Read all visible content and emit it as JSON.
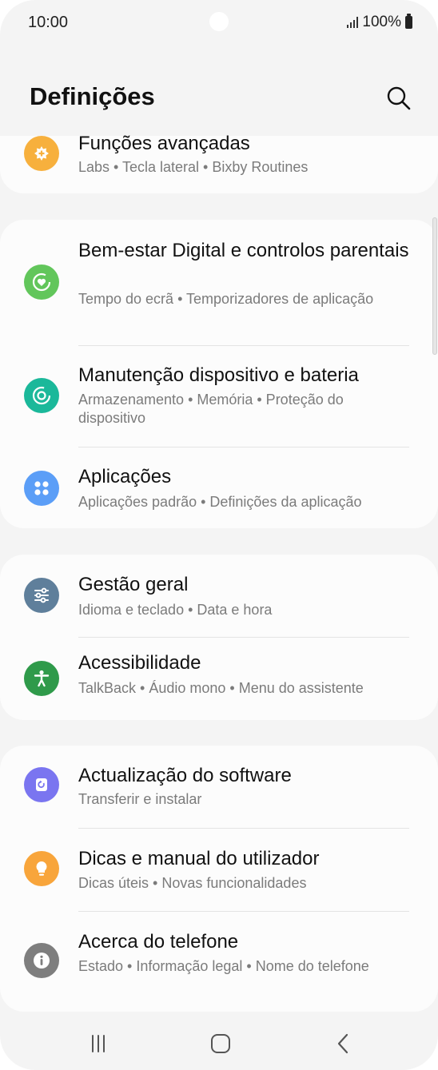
{
  "status_bar": {
    "time": "10:00",
    "battery": "100%"
  },
  "header": {
    "title": "Definições"
  },
  "cards": [
    {
      "items": [
        {
          "title": "Funções avançadas",
          "subtitle": "Labs  •  Tecla lateral  •  Bixby Routines",
          "icon": "plus-gear-icon",
          "color": "#f7b03d"
        }
      ]
    },
    {
      "items": [
        {
          "title": "Bem-estar Digital e controlos parentais",
          "subtitle": "Tempo do ecrã  •  Temporizadores de aplicação",
          "icon": "heart-circle-icon",
          "color": "#62c65b"
        },
        {
          "title": "Manutenção dispositivo e bateria",
          "subtitle": "Armazenamento  •  Memória  •  Proteção do dispositivo",
          "icon": "refresh-circle-icon",
          "color": "#1bb89a"
        },
        {
          "title": "Aplicações",
          "subtitle": "Aplicações padrão  •  Definições da aplicação",
          "icon": "apps-grid-icon",
          "color": "#5b9ef7"
        }
      ]
    },
    {
      "items": [
        {
          "title": "Gestão geral",
          "subtitle": "Idioma e teclado  •  Data e hora",
          "icon": "sliders-icon",
          "color": "#5f7f9b"
        },
        {
          "title": "Acessibilidade",
          "subtitle": "TalkBack  •  Áudio mono  •  Menu do assistente",
          "icon": "accessibility-icon",
          "color": "#2f9a4a"
        }
      ]
    },
    {
      "items": [
        {
          "title": "Actualização do software",
          "subtitle": "Transferir e instalar",
          "icon": "update-icon",
          "color": "#7a75f0"
        },
        {
          "title": "Dicas e manual do utilizador",
          "subtitle": "Dicas úteis  •  Novas funcionalidades",
          "icon": "lightbulb-icon",
          "color": "#f8a53b"
        },
        {
          "title": "Acerca do telefone",
          "subtitle": "Estado  •  Informação legal  •  Nome do telefone",
          "icon": "info-icon",
          "color": "#7e7e7e"
        }
      ]
    }
  ],
  "nav": {
    "recents": "recents-icon",
    "home": "home-icon",
    "back": "back-icon"
  }
}
